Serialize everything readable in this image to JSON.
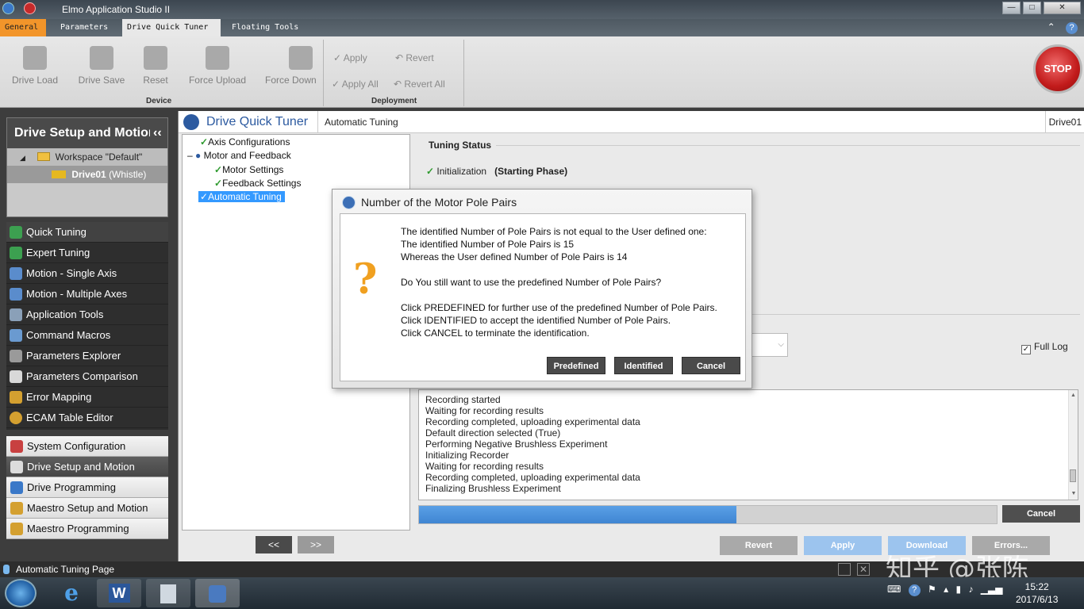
{
  "window": {
    "title": "Elmo Application Studio II"
  },
  "tabs": [
    "General",
    "Parameters",
    "Drive Quick Tuner",
    "Floating Tools"
  ],
  "ribbon": {
    "device": {
      "label": "Device",
      "buttons": [
        "Drive Load",
        "Drive Save",
        "Reset",
        "Force Upload",
        "Force Down"
      ]
    },
    "deployment": {
      "label": "Deployment",
      "apply": "Apply",
      "revert": "Revert",
      "apply_all": "Apply All",
      "revert_all": "Revert All"
    },
    "stop": "STOP"
  },
  "left_panel": {
    "title": "Drive Setup and Motion",
    "workspace": "Workspace \"Default\"",
    "drive": "Drive01",
    "drive_suffix": "(Whistle)"
  },
  "nav_items": [
    "Quick Tuning",
    "Expert Tuning",
    "Motion - Single Axis",
    "Motion - Multiple Axes",
    "Application Tools",
    "Command Macros",
    "Parameters Explorer",
    "Parameters Comparison",
    "Error Mapping",
    "ECAM Table Editor"
  ],
  "system_items": [
    "System Configuration",
    "Drive Setup and Motion",
    "Drive Programming",
    "Maestro Setup and Motion",
    "Maestro Programming"
  ],
  "main": {
    "title": "Drive Quick Tuner",
    "subtitle": "Automatic Tuning",
    "drive": "Drive01",
    "tree": {
      "axis_config": "Axis Configurations",
      "motor_feedback": "Motor and Feedback",
      "motor_settings": "Motor Settings",
      "feedback_settings": "Feedback Settings",
      "automatic_tuning": "Automatic Tuning"
    },
    "nav_prev": "<<",
    "nav_next": ">>",
    "tuning_status": "Tuning Status",
    "init_label": "Initialization",
    "init_phase": "(Starting Phase)",
    "full_log": "Full Log",
    "log_lines": [
      "Recording started",
      "Waiting for recording results",
      "Recording completed, uploading experimental data",
      "Default direction selected (True)",
      "Performing Negative Brushless Experiment",
      "Initializing Recorder",
      "Waiting for recording results",
      "Recording completed, uploading experimental data",
      "Finalizing Brushless Experiment"
    ],
    "progress": 0.55,
    "progress_cancel": "Cancel",
    "buttons": {
      "revert": "Revert",
      "apply": "Apply",
      "download": "Download",
      "errors": "Errors..."
    }
  },
  "dialog": {
    "title": "Number of the Motor Pole Pairs",
    "lines": [
      "The identified Number of Pole Pairs is not equal to the User defined one:",
      "The identified Number of Pole Pairs is 15",
      "Whereas the User defined Number of Pole Pairs is 14",
      "",
      "Do You still want to use the predefined Number of Pole Pairs?",
      "",
      "Click PREDEFINED for further use of the predefined Number of Pole Pairs.",
      "Click IDENTIFIED to accept the identified Number of Pole Pairs.",
      "Click CANCEL to terminate the identification."
    ],
    "buttons": {
      "predefined": "Predefined",
      "identified": "Identified",
      "cancel": "Cancel"
    }
  },
  "status_bar": "Automatic Tuning Page",
  "watermark": "知乎 @张陈",
  "taskbar": {
    "time": "15:22",
    "date": "2017/6/13"
  },
  "colors": {
    "accent_orange": "#f2952a",
    "progress_blue": "#3f85d2",
    "stop_red": "#c21b1b",
    "tree_select": "#3399ff"
  }
}
